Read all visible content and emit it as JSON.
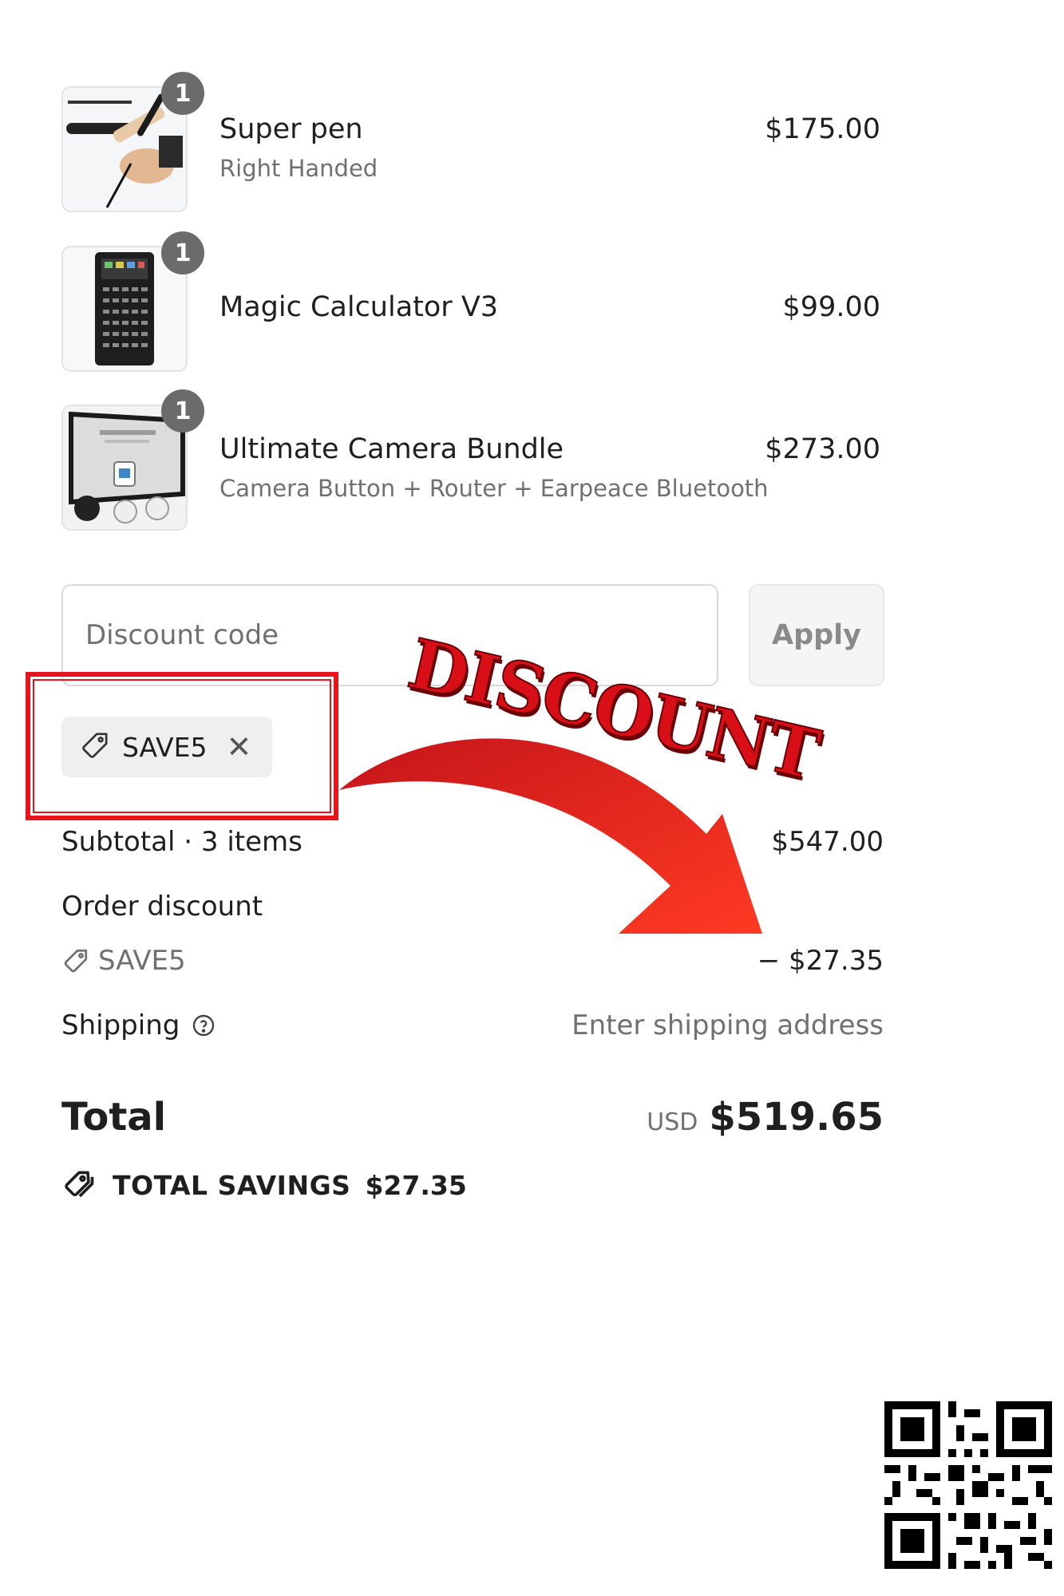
{
  "cart": {
    "items": [
      {
        "name": "Super pen",
        "variant": "Right Handed",
        "price": "$175.00",
        "quantity": "1"
      },
      {
        "name": "Magic Calculator V3",
        "variant": "",
        "price": "$99.00",
        "quantity": "1"
      },
      {
        "name": "Ultimate Camera Bundle",
        "variant": "Camera Button + Router + Earpeace Bluetooth",
        "price": "$273.00",
        "quantity": "1"
      }
    ]
  },
  "discount": {
    "placeholder": "Discount code",
    "apply_label": "Apply",
    "applied_code": "SAVE5"
  },
  "summary": {
    "subtotal_label": "Subtotal · 3 items",
    "subtotal_value": "$547.00",
    "order_discount_label": "Order discount",
    "order_discount_code": "SAVE5",
    "order_discount_value": "− $27.35",
    "shipping_label": "Shipping",
    "shipping_value": "Enter shipping address",
    "total_label": "Total",
    "currency": "USD",
    "total_value": "$519.65",
    "savings_label": "TOTAL SAVINGS",
    "savings_value": "$27.35"
  },
  "overlay": {
    "banner_text": "DISCOUNT",
    "accent_color": "#e8141b"
  },
  "icons": [
    "tag-icon",
    "close-icon",
    "help-circle-icon",
    "savings-tag-icon",
    "arrow-icon",
    "qr-code"
  ]
}
